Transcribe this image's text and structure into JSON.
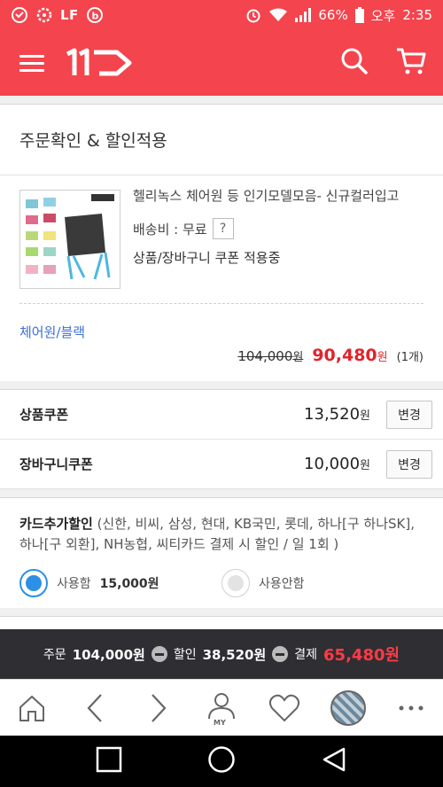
{
  "status_bar": {
    "app_label": "LF",
    "battery": "66%",
    "ampm": "오후",
    "time": "2:35"
  },
  "header": {
    "logo": "11",
    "logo_icon": "11st-arrow-logo",
    "search_icon": "search-icon",
    "cart_icon": "cart-icon"
  },
  "order": {
    "section_title": "주문확인 & 할인적용",
    "product": {
      "name": "헬리녹스 체어원 등 인기모델모음- 신규컬러입고",
      "shipping_label": "배송비 : 무료",
      "shipping_help": "?",
      "coupon_status": "상품/장바구니 쿠폰 적용중",
      "option": "체어원/블랙",
      "original_price": "104,000",
      "original_unit": "원",
      "sale_price": "90,480",
      "sale_unit": "원",
      "quantity": "(1개)"
    }
  },
  "coupons": [
    {
      "label": "상품쿠폰",
      "amount": "13,520",
      "unit": "원",
      "button": "변경"
    },
    {
      "label": "장바구니쿠폰",
      "amount": "10,000",
      "unit": "원",
      "button": "변경"
    }
  ],
  "card_discount": {
    "title": "카드추가할인",
    "description": " (신한, 비씨, 삼성, 현대, KB국민, 롯데, 하나[구 하나SK], 하나[구 외환], NH농협, 씨티카드 결제 시 할인 / 일 1회 )",
    "use_label": "사용함",
    "use_amount": "15,000원",
    "no_use_label": "사용안함",
    "selected": "use",
    "accent_color": "#2d8fe5"
  },
  "summary": {
    "order_label": "주문",
    "order_amount": "104,000원",
    "discount_label": "할인",
    "discount_amount": "38,520원",
    "payment_label": "결제",
    "payment_amount": "65,480원"
  },
  "bottom_nav": {
    "items": [
      "home-icon",
      "back-icon",
      "forward-icon",
      "my-icon",
      "heart-icon",
      "recent-product-icon",
      "more-icon"
    ],
    "my_label": "MY"
  },
  "colors": {
    "brand": "#f4444d",
    "sale_price": "#e2232a",
    "option_link": "#3b6fd8",
    "summary_bg": "#2e2e33",
    "summary_total": "#ff3b45"
  }
}
